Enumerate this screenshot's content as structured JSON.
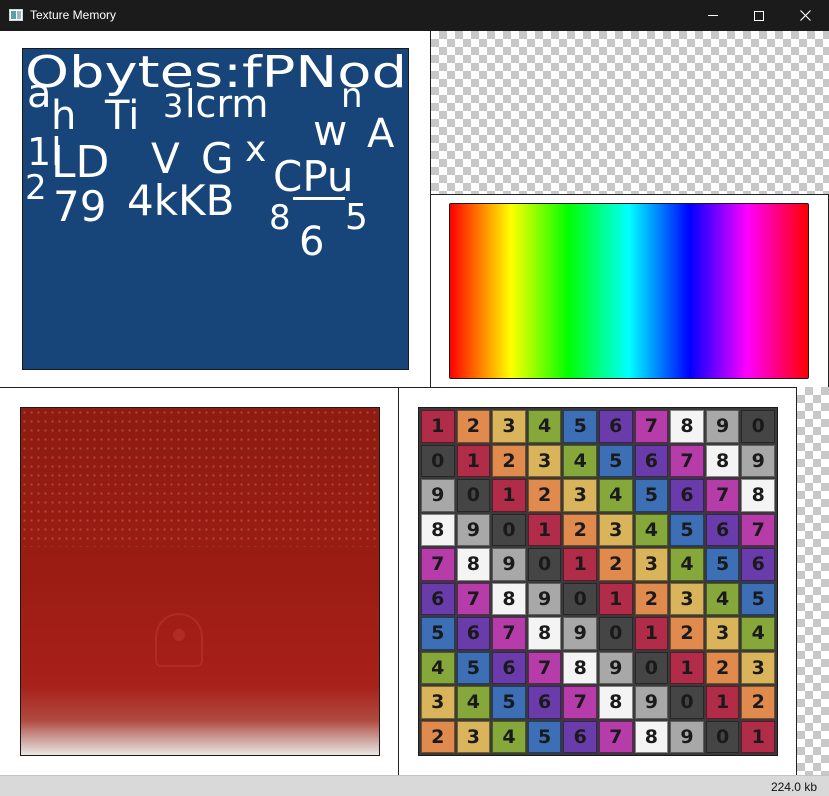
{
  "window": {
    "title": "Texture Memory",
    "controls": {
      "minimize": "minimize-icon",
      "maximize": "maximize-icon",
      "close": "close-icon"
    }
  },
  "font_atlas": {
    "background": "#174479",
    "glyphs": [
      {
        "text": "Obytes:fPNod"
      },
      {
        "text": "a"
      },
      {
        "text": "h"
      },
      {
        "text": "Ti"
      },
      {
        "text": "3"
      },
      {
        "text": "lcrm"
      },
      {
        "text": "n"
      },
      {
        "text": "w"
      },
      {
        "text": "A"
      },
      {
        "text": "1l"
      },
      {
        "text": "LD"
      },
      {
        "text": "V"
      },
      {
        "text": "G"
      },
      {
        "text": "x"
      },
      {
        "text": "CPu"
      },
      {
        "text": "2"
      },
      {
        "text": "79"
      },
      {
        "text": "4kKB"
      },
      {
        "text": "8"
      },
      {
        "text": "6"
      },
      {
        "text": "5"
      }
    ]
  },
  "hue_strip": {
    "colors": [
      "#ff0000",
      "#ffff00",
      "#00ff00",
      "#00ffff",
      "#0000ff",
      "#ff00ff",
      "#ff0000"
    ]
  },
  "red_texture": {
    "color": "#9a1c12"
  },
  "number_grid": {
    "palette": {
      "0": "#454545",
      "1": "#b02c48",
      "2": "#e08a4e",
      "3": "#d9b45a",
      "4": "#86a83b",
      "5": "#3c6fb5",
      "6": "#6a3cab",
      "7": "#b53ca9",
      "8": "#f4f4f4",
      "9": "#a8a8a8"
    },
    "rows": [
      [
        "1",
        "2",
        "3",
        "4",
        "5",
        "6",
        "7",
        "8",
        "9",
        "0"
      ],
      [
        "0",
        "1",
        "2",
        "3",
        "4",
        "5",
        "6",
        "7",
        "8",
        "9"
      ],
      [
        "9",
        "0",
        "1",
        "2",
        "3",
        "4",
        "5",
        "6",
        "7",
        "8"
      ],
      [
        "8",
        "9",
        "0",
        "1",
        "2",
        "3",
        "4",
        "5",
        "6",
        "7"
      ],
      [
        "7",
        "8",
        "9",
        "0",
        "1",
        "2",
        "3",
        "4",
        "5",
        "6"
      ],
      [
        "6",
        "7",
        "8",
        "9",
        "0",
        "1",
        "2",
        "3",
        "4",
        "5"
      ],
      [
        "5",
        "6",
        "7",
        "8",
        "9",
        "0",
        "1",
        "2",
        "3",
        "4"
      ],
      [
        "4",
        "5",
        "6",
        "7",
        "8",
        "9",
        "0",
        "1",
        "2",
        "3"
      ],
      [
        "3",
        "4",
        "5",
        "6",
        "7",
        "8",
        "9",
        "0",
        "1",
        "2"
      ],
      [
        "2",
        "3",
        "4",
        "5",
        "6",
        "7",
        "8",
        "9",
        "0",
        "1"
      ]
    ]
  },
  "status": {
    "memory": "224.0 kb"
  }
}
